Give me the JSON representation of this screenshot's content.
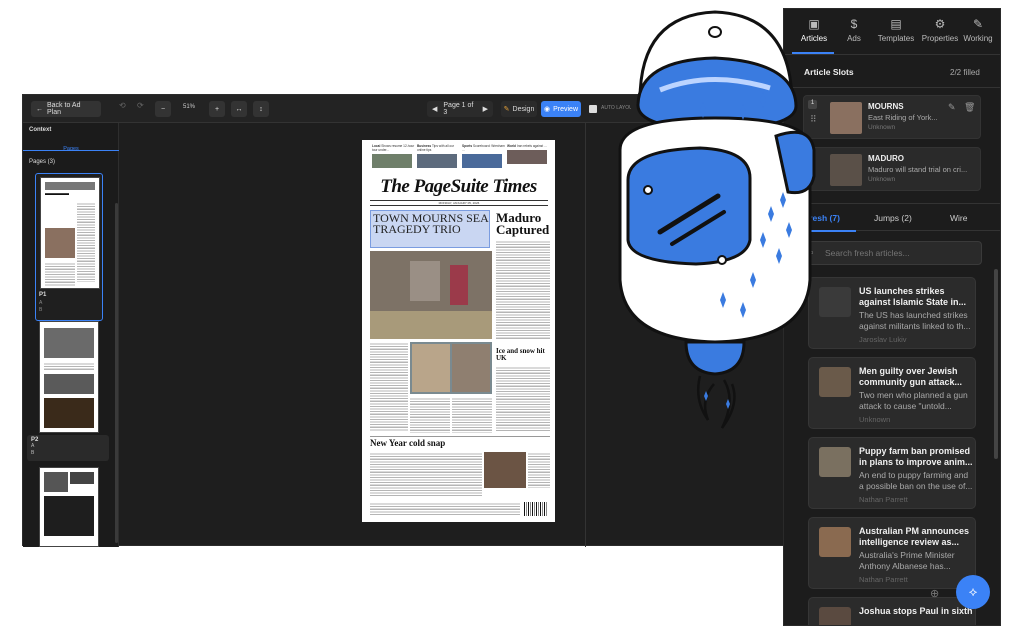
{
  "editor": {
    "back_label": "Back to Ad Plan",
    "zoom": "51%",
    "zoom_out": "−",
    "zoom_in": "+",
    "fit_width": "↔",
    "fit_height": "↕",
    "page_indicator": "Page 1 of 3",
    "design_label": "Design",
    "preview_label": "Preview",
    "auto_label": "AUTO LAYOUT",
    "context_label": "Context",
    "pages_tab": "Pages",
    "pages_header": "Pages (3)",
    "pages": [
      {
        "label": "P1",
        "sub1": "A",
        "sub2": "B"
      },
      {
        "label": "P2",
        "sub1": "A",
        "sub2": "B"
      }
    ]
  },
  "newspaper": {
    "topics": [
      {
        "head": "Local",
        "text": "Shows resume 12-hour tour under..."
      },
      {
        "head": "Business",
        "text": "Tips with all our online tips"
      },
      {
        "head": "Sports",
        "text": "Scoreboard: Wrexham ..."
      },
      {
        "head": "World",
        "text": "Iran rebels against ..."
      }
    ],
    "masthead": "The PageSuite Times",
    "dateline": "MONDAY, JANUARY 05, 2026",
    "lead_headline": "TOWN MOURNS SEA TRAGEDY TRIO",
    "side_headline": "Maduro Captured",
    "mid_headline": "Ice and snow hit UK",
    "bottom_headline": "New Year cold snap"
  },
  "panel": {
    "tabs": [
      {
        "label": "Articles",
        "icon": "🖼"
      },
      {
        "label": "Ads",
        "icon": "💰"
      },
      {
        "label": "Templates",
        "icon": "📄"
      },
      {
        "label": "Properties",
        "icon": "⚙"
      },
      {
        "label": "Working",
        "icon": "🔧"
      }
    ],
    "slots_title": "Article Slots",
    "slots_count": "2/2 filled",
    "slots": [
      {
        "num": "1",
        "title": "MOURNS",
        "subtitle": "East Riding of York...",
        "author": "Unknown"
      },
      {
        "title": "MADURO",
        "subtitle": "Maduro will stand trial on cri...",
        "author": "Unknown"
      }
    ],
    "subtabs": [
      "Fresh (7)",
      "Jumps (2)",
      "Wire"
    ],
    "search_placeholder": "Search fresh articles...",
    "articles": [
      {
        "title": "US launches strikes against Islamic State in...",
        "summary": "The US has launched strikes against militants linked to th...",
        "author": "Jaroslav Lukiv"
      },
      {
        "title": "Men guilty over Jewish community gun attack...",
        "summary": "Two men who planned a gun attack to cause \"untold...",
        "author": "Unknown"
      },
      {
        "title": "Puppy farm ban promised in plans to improve anim...",
        "summary": "An end to puppy farming and a possible ban on the use of...",
        "author": "Nathan Parrett"
      },
      {
        "title": "Australian PM announces intelligence review as...",
        "summary": "Australia's Prime Minister Anthony Albanese has...",
        "author": "Nathan Parrett"
      },
      {
        "title": "Joshua stops Paul in sixth",
        "summary": "",
        "author": ""
      }
    ]
  },
  "colors": {
    "accent": "#3b82f6",
    "robot_blue": "#3a7be0",
    "panel_bg": "#1c1c1c"
  }
}
